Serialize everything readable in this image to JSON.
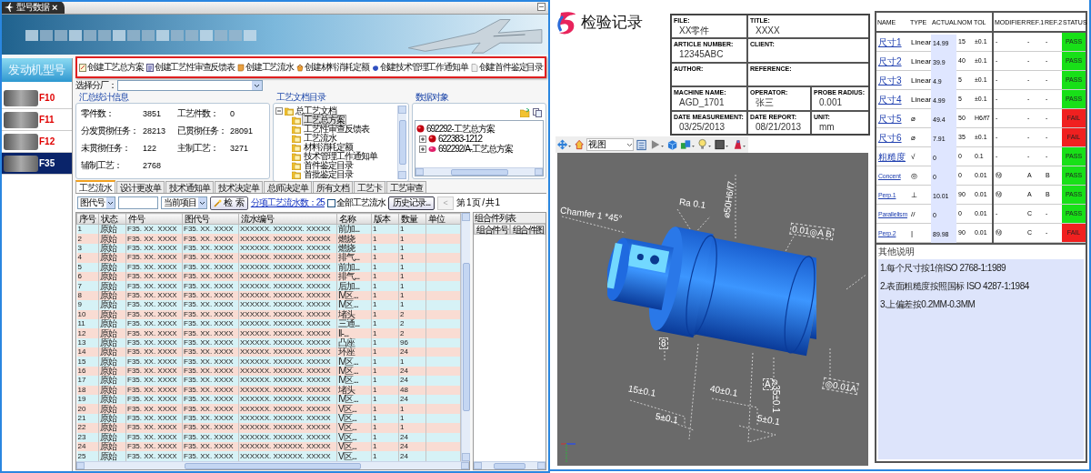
{
  "app": {
    "tab": {
      "title": "型号数据",
      "close": "×"
    },
    "sidebar": {
      "title": "发动机型号",
      "items": [
        {
          "label": "F10",
          "selected": false
        },
        {
          "label": "F11",
          "selected": false
        },
        {
          "label": "F12",
          "selected": false
        },
        {
          "label": "F35",
          "selected": true
        }
      ]
    },
    "toolbar": [
      {
        "label": "创建工艺总方案"
      },
      {
        "label": "创建工艺性审查反馈表"
      },
      {
        "label": "创建工艺流水"
      },
      {
        "label": "创建材料消耗定额"
      },
      {
        "label": "创建技术管理工作通知单"
      },
      {
        "label": "创建首件鉴定目录"
      }
    ],
    "factory": {
      "label": "选择分厂："
    },
    "summary": {
      "title": "汇总统计信息",
      "stats": [
        {
          "label": "零件数：",
          "value": "3851"
        },
        {
          "label": "工艺件数：",
          "value": "0"
        },
        {
          "label": "分发贯彻任务：",
          "value": "28213"
        },
        {
          "label": "已贯彻任务：",
          "value": "28091"
        },
        {
          "label": "未贯彻任务：",
          "value": "122"
        },
        {
          "label": "主制工艺：",
          "value": "3271"
        },
        {
          "label": "辅制工艺：",
          "value": "2768"
        }
      ]
    },
    "doc_tree": {
      "title": "工艺文档目录",
      "root": {
        "label": "总工艺文档",
        "expanded": true,
        "children": [
          {
            "label": "工艺总方案",
            "selected": true
          },
          {
            "label": "工艺性审查反馈表",
            "selected": false
          },
          {
            "label": "工艺流水",
            "selected": false
          },
          {
            "label": "材料消耗定额",
            "selected": false
          },
          {
            "label": "技术管理工作通知单",
            "selected": false
          },
          {
            "label": "首件鉴定目录",
            "selected": false
          },
          {
            "label": "首批鉴定目录",
            "selected": false
          }
        ]
      }
    },
    "data_objects": {
      "title": "数据对象",
      "items": [
        {
          "label": "692292-工艺总方案",
          "children": [
            {
              "label": "622383-1212",
              "expanded": false
            },
            {
              "label": "692292/A-工艺总方案",
              "expanded": false
            }
          ]
        }
      ]
    },
    "tabs": [
      {
        "label": "工艺流水",
        "selected": true
      },
      {
        "label": "设计更改单",
        "selected": false
      },
      {
        "label": "技术通知单",
        "selected": false
      },
      {
        "label": "技术决定单",
        "selected": false
      },
      {
        "label": "总师决定单",
        "selected": false
      },
      {
        "label": "所有文档",
        "selected": false
      },
      {
        "label": "工艺卡",
        "selected": false
      },
      {
        "label": "工艺审查",
        "selected": false
      }
    ],
    "filter": {
      "field": "图代号",
      "scope": "当前项目",
      "search": "检 索",
      "link": "分项工艺流水数：25",
      "all_checkbox": {
        "label": "全部工艺流水",
        "checked": false
      },
      "history": "历史记录...",
      "prev": {
        "label": "<",
        "disabled": true
      },
      "page": "第 1 页 / 共 1"
    },
    "table": {
      "columns": [
        "序号",
        "状态",
        "件号",
        "图代号",
        "流水编号",
        "名称",
        "版本",
        "数量",
        "单位"
      ],
      "rows": [
        [
          "1",
          "原始",
          "F35. XX. XXXX",
          "F35. XX. XXXX",
          "XXXXXX. XXXXXX. XXXXX",
          "前加...",
          "1",
          "1"
        ],
        [
          "2",
          "原始",
          "F35. XX. XXXX",
          "F35. XX. XXXX",
          "XXXXXX. XXXXXX. XXXXX",
          "燃烧",
          "1",
          "1"
        ],
        [
          "3",
          "原始",
          "F35. XX. XXXX",
          "F35. XX. XXXX",
          "XXXXXX. XXXXXX. XXXXX",
          "燃烧",
          "1",
          "1"
        ],
        [
          "4",
          "原始",
          "F35. XX. XXXX",
          "F35. XX. XXXX",
          "XXXXXX. XXXXXX. XXXXX",
          "排气...",
          "1",
          "1"
        ],
        [
          "5",
          "原始",
          "F35. XX. XXXX",
          "F35. XX. XXXX",
          "XXXXXX. XXXXXX. XXXXX",
          "前加...",
          "1",
          "1"
        ],
        [
          "6",
          "原始",
          "F35. XX. XXXX",
          "F35. XX. XXXX",
          "XXXXXX. XXXXXX. XXXXX",
          "排气...",
          "1",
          "1"
        ],
        [
          "7",
          "原始",
          "F35. XX. XXXX",
          "F35. XX. XXXX",
          "XXXXXX. XXXXXX. XXXXX",
          "后加...",
          "1",
          "1"
        ],
        [
          "8",
          "原始",
          "F35. XX. XXXX",
          "F35. XX. XXXX",
          "XXXXXX. XXXXXX. XXXXX",
          "IV区...",
          "1",
          "1"
        ],
        [
          "9",
          "原始",
          "F35. XX. XXXX",
          "F35. XX. XXXX",
          "XXXXXX. XXXXXX. XXXXX",
          "IV区...",
          "1",
          "1"
        ],
        [
          "10",
          "原始",
          "F35. XX. XXXX",
          "F35. XX. XXXX",
          "XXXXXX. XXXXXX. XXXXX",
          "堵头",
          "1",
          "2"
        ],
        [
          "11",
          "原始",
          "F35. XX. XXXX",
          "F35. XX. XXXX",
          "XXXXXX. XXXXXX. XXXXX",
          "三通...",
          "1",
          "2"
        ],
        [
          "12",
          "原始",
          "F35. XX. XXXX",
          "F35. XX. XXXX",
          "XXXXXX. XXXXXX. XXXXX",
          "II-...",
          "1",
          "2"
        ],
        [
          "13",
          "原始",
          "F35. XX. XXXX",
          "F35. XX. XXXX",
          "XXXXXX. XXXXXX. XXXXX",
          "凸座",
          "1",
          "96"
        ],
        [
          "14",
          "原始",
          "F35. XX. XXXX",
          "F35. XX. XXXX",
          "XXXXXX. XXXXXX. XXXXX",
          "环座",
          "1",
          "24"
        ],
        [
          "15",
          "原始",
          "F35. XX. XXXX",
          "F35. XX. XXXX",
          "XXXXXX. XXXXXX. XXXXX",
          "IV区...",
          "1",
          "1"
        ],
        [
          "16",
          "原始",
          "F35. XX. XXXX",
          "F35. XX. XXXX",
          "XXXXXX. XXXXXX. XXXXX",
          "IV区...",
          "1",
          "24"
        ],
        [
          "17",
          "原始",
          "F35. XX. XXXX",
          "F35. XX. XXXX",
          "XXXXXX. XXXXXX. XXXXX",
          "IV区...",
          "1",
          "24"
        ],
        [
          "18",
          "原始",
          "F35. XX. XXXX",
          "F35. XX. XXXX",
          "XXXXXX. XXXXXX. XXXXX",
          "堵头",
          "1",
          "48"
        ],
        [
          "19",
          "原始",
          "F35. XX. XXXX",
          "F35. XX. XXXX",
          "XXXXXX. XXXXXX. XXXXX",
          "IV区...",
          "1",
          "24"
        ],
        [
          "20",
          "原始",
          "F35. XX. XXXX",
          "F35. XX. XXXX",
          "XXXXXX. XXXXXX. XXXXX",
          "V区...",
          "1",
          "1"
        ],
        [
          "21",
          "原始",
          "F35. XX. XXXX",
          "F35. XX. XXXX",
          "XXXXXX. XXXXXX. XXXXX",
          "V区...",
          "1",
          "1"
        ],
        [
          "22",
          "原始",
          "F35. XX. XXXX",
          "F35. XX. XXXX",
          "XXXXXX. XXXXXX. XXXXX",
          "V区...",
          "1",
          "1"
        ],
        [
          "23",
          "原始",
          "F35. XX. XXXX",
          "F35. XX. XXXX",
          "XXXXXX. XXXXXX. XXXXX",
          "V区...",
          "1",
          "24"
        ],
        [
          "24",
          "原始",
          "F35. XX. XXXX",
          "F35. XX. XXXX",
          "XXXXXX. XXXXXX. XXXXX",
          "V区...",
          "1",
          "24"
        ],
        [
          "25",
          "原始",
          "F35. XX. XXXX",
          "F35. XX. XXXX",
          "XXXXXX. XXXXXX. XXXXX",
          "V区...",
          "1",
          "24"
        ]
      ]
    },
    "assembly": {
      "title": "组合件列表",
      "columns": [
        "组合件号",
        "组合件图"
      ]
    }
  },
  "report": {
    "title": "检验记录",
    "info": [
      [
        {
          "label": "FILE:",
          "value": "XX零件"
        },
        {
          "label": "TITLE:",
          "value": "XXXX"
        }
      ],
      [
        {
          "label": "ARTICLE NUMBER:",
          "value": "12345ABC"
        },
        {
          "label": "CLIENT:"
        }
      ],
      [
        {
          "label": "AUTHOR:"
        },
        {
          "label": "REFERENCE:"
        }
      ],
      [
        {
          "label": "MACHINE NAME:",
          "value": "AGD_1701"
        },
        {
          "label": "OPERATOR:",
          "value": "张三"
        },
        {
          "label": "PROBE RADIUS:",
          "value": "0.001"
        }
      ],
      [
        {
          "label": "DATE MEASUREMENT:",
          "value": "03/25/2013"
        },
        {
          "label": "DATE REPORT:",
          "value": "08/21/2013"
        },
        {
          "label": "UNIT:",
          "value": "mm"
        }
      ]
    ],
    "viewer": {
      "view_select": "视图",
      "annotations": [
        "Chamfer 1 *45°",
        "Ra 0.1",
        "⌀50H6/f7",
        "0.01◎A B",
        "8",
        "A",
        "15±0.1",
        "40±0.1",
        "5±0.1",
        "5±0.1",
        "⌀35±0.1",
        "◎0.01A"
      ]
    },
    "results": {
      "columns": [
        "NAME",
        "TYPE",
        "ACTUAL",
        "NOM",
        "TOL",
        "MODIFIER",
        "REF.1",
        "REF.2",
        "STATUS"
      ],
      "rows": [
        {
          "cells": [
            "尺寸1",
            "Linear",
            "14.99",
            "15",
            "±0.1",
            "-",
            "-",
            "-"
          ],
          "status": "PASS",
          "passed": true
        },
        {
          "cells": [
            "尺寸2",
            "Linear",
            "39.9",
            "40",
            "±0.1",
            "-",
            "-",
            "-"
          ],
          "status": "PASS",
          "passed": true
        },
        {
          "cells": [
            "尺寸3",
            "Linear",
            "4.9",
            "5",
            "±0.1",
            "-",
            "-",
            "-"
          ],
          "status": "PASS",
          "passed": true
        },
        {
          "cells": [
            "尺寸4",
            "Linear",
            "4.99",
            "5",
            "±0.1",
            "-",
            "-",
            "-"
          ],
          "status": "PASS",
          "passed": true
        },
        {
          "cells": [
            "尺寸5",
            "⌀",
            "49.4",
            "50",
            "H6/f7",
            "-",
            "-",
            "-"
          ],
          "status": "FAIL",
          "passed": false
        },
        {
          "cells": [
            "尺寸6",
            "⌀",
            "7.91",
            "35",
            "±0.1",
            "-",
            "-",
            "-"
          ],
          "status": "FAIL",
          "passed": false
        },
        {
          "cells": [
            "粗糙度",
            "√",
            "0",
            "0",
            "0.1",
            "-",
            "-",
            "-"
          ],
          "status": "PASS",
          "passed": true
        },
        {
          "cells": [
            "Concent",
            "◎",
            "0",
            "0",
            "0.01",
            "Ⓜ",
            "A",
            "B"
          ],
          "status": "PASS",
          "passed": true
        },
        {
          "cells": [
            "Perp.1",
            "⊥",
            "10.01",
            "90",
            "0.01",
            "Ⓜ",
            "A",
            "B"
          ],
          "status": "PASS",
          "passed": true
        },
        {
          "cells": [
            "Parallelism",
            "//",
            "0",
            "0",
            "0.01",
            "-",
            "C",
            "-"
          ],
          "status": "PASS",
          "passed": true
        },
        {
          "cells": [
            "Perp.2",
            "|",
            "89.98",
            "90",
            "0.01",
            "Ⓜ",
            "C",
            "-"
          ],
          "status": "FAIL",
          "passed": false
        }
      ]
    },
    "remarks": {
      "title": "其他说明",
      "lines": [
        "1.每个尺寸按1倍ISO 2768-1:1989",
        "2.表面粗糙度按照国标 ISO 4287-1:1984",
        "3.上偏差按0.2MM-0.3MM"
      ]
    }
  }
}
